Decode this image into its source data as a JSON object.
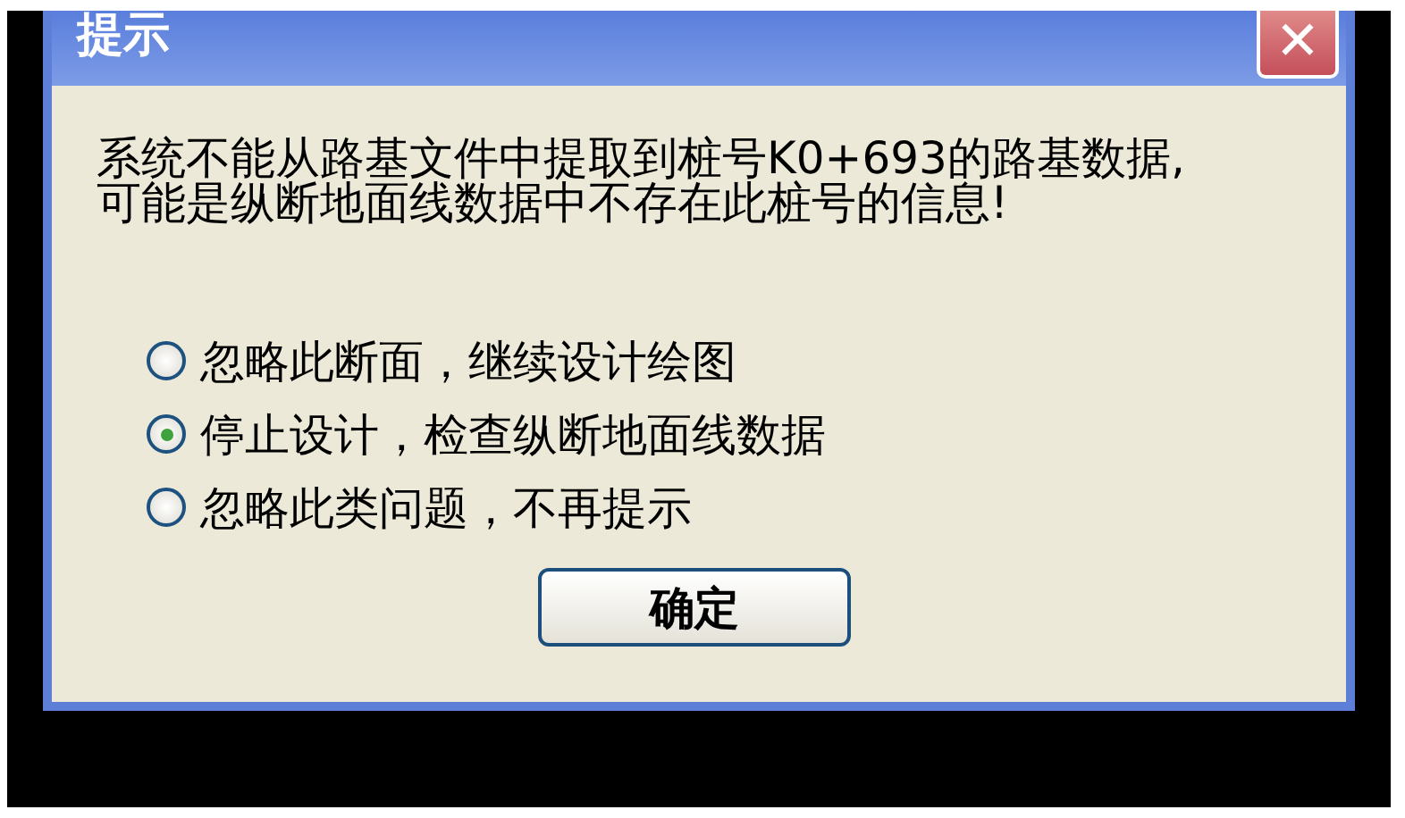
{
  "window": {
    "title": "提示",
    "close": "✕"
  },
  "message_lines": [
    "系统不能从路基文件中提取到桩号K0+693的路基数据,",
    "可能是纵断地面线数据中不存在此桩号的信息!"
  ],
  "options": [
    {
      "label": "忽略此断面，继续设计绘图",
      "selected": false
    },
    {
      "label": "停止设计，检查纵断地面线数据",
      "selected": true
    },
    {
      "label": "忽略此类问题，不再提示",
      "selected": false
    }
  ],
  "buttons": [
    "确定"
  ]
}
